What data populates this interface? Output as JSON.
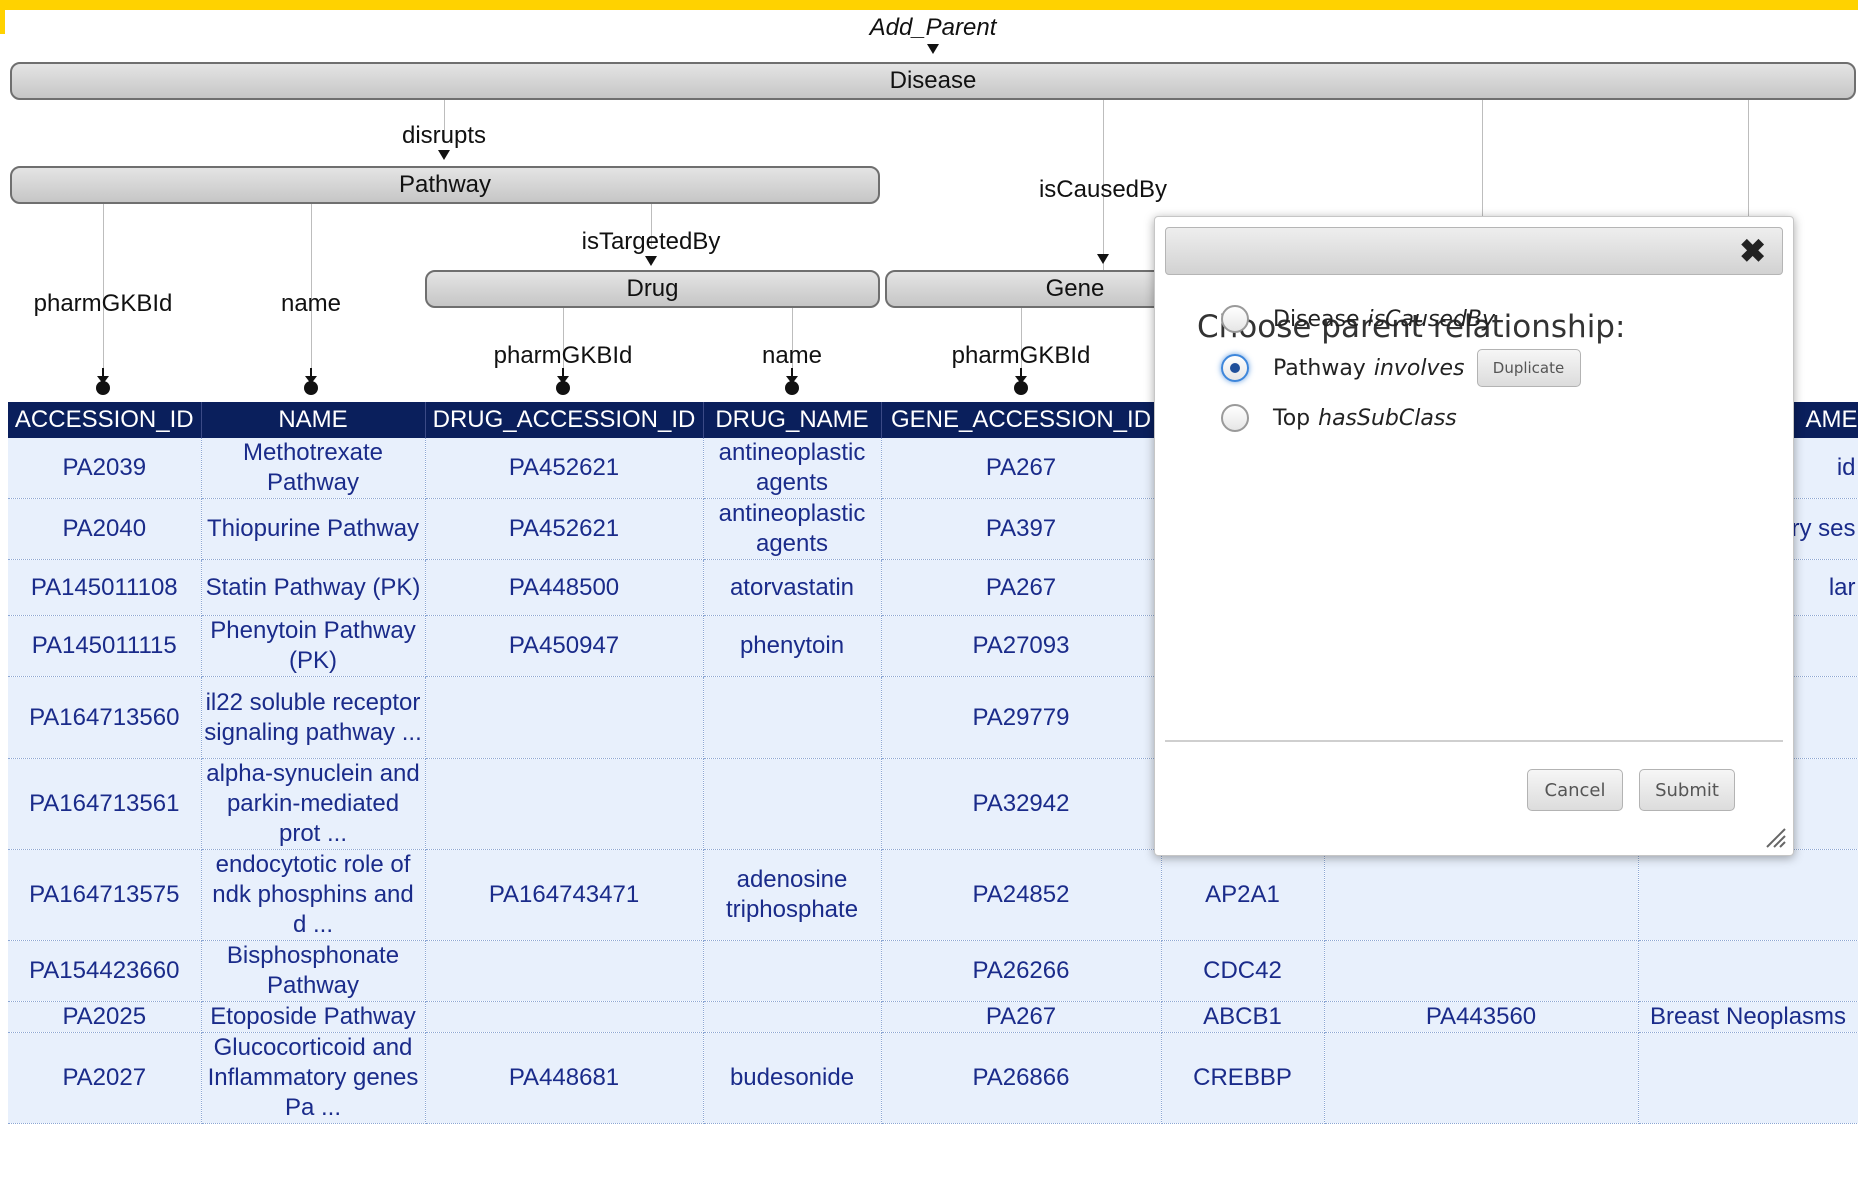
{
  "schema": {
    "root_label": "Add_Parent",
    "bars": {
      "disease": "Disease",
      "pathway": "Pathway",
      "drug": "Drug",
      "gene": "Gene"
    },
    "relations": {
      "disrupts": "disrupts",
      "is_targeted_by": "isTargetedBy",
      "is_caused_by": "isCausedBy"
    },
    "attributes": {
      "pathway_id": "pharmGKBId",
      "pathway_name": "name",
      "drug_id": "pharmGKBId",
      "drug_name": "name",
      "gene_id": "pharmGKBId"
    }
  },
  "table": {
    "columns": [
      "ACCESSION_ID",
      "NAME",
      "DRUG_ACCESSION_ID",
      "DRUG_NAME",
      "GENE_ACCESSION_ID",
      "",
      "",
      "AME"
    ],
    "rows": [
      [
        "PA2039",
        "Methotrexate Pathway",
        "PA452621",
        "antineoplastic agents",
        "PA267",
        "",
        "",
        "id"
      ],
      [
        "PA2040",
        "Thiopurine Pathway",
        "PA452621",
        "antineoplastic agents",
        "PA397",
        "",
        "",
        "ry ses"
      ],
      [
        "PA145011108",
        "Statin Pathway (PK)",
        "PA448500",
        "atorvastatin",
        "PA267",
        "",
        "",
        "lar"
      ],
      [
        "PA145011115",
        "Phenytoin Pathway (PK)",
        "PA450947",
        "phenytoin",
        "PA27093",
        "",
        "",
        ""
      ],
      [
        "PA164713560",
        "il22 soluble receptor signaling pathway ...",
        "",
        "",
        "PA29779",
        "",
        "",
        ""
      ],
      [
        "PA164713561",
        "alpha-synuclein and parkin-mediated prot ...",
        "",
        "",
        "PA32942",
        "",
        "",
        ""
      ],
      [
        "PA164713575",
        "endocytotic role of ndk phosphins and d ...",
        "PA164743471",
        "adenosine triphosphate",
        "PA24852",
        "AP2A1",
        "",
        ""
      ],
      [
        "PA154423660",
        "Bisphosphonate Pathway",
        "",
        "",
        "PA26266",
        "CDC42",
        "",
        ""
      ],
      [
        "PA2025",
        "Etoposide Pathway",
        "",
        "",
        "PA267",
        "ABCB1",
        "PA443560",
        "Breast Neoplasms"
      ],
      [
        "PA2027",
        "Glucocorticoid and Inflammatory genes Pa ...",
        "PA448681",
        "budesonide",
        "PA26866",
        "CREBBP",
        "",
        ""
      ]
    ]
  },
  "dialog": {
    "close_icon": "close-icon",
    "heading": "Choose parent relationship:",
    "options": [
      {
        "parent": "Disease",
        "relation": "isCausedBy",
        "selected": false
      },
      {
        "parent": "Pathway",
        "relation": "involves",
        "selected": true
      },
      {
        "parent": "Top",
        "relation": "hasSubClass",
        "selected": false
      }
    ],
    "duplicate_label": "Duplicate",
    "cancel_label": "Cancel",
    "submit_label": "Submit"
  }
}
